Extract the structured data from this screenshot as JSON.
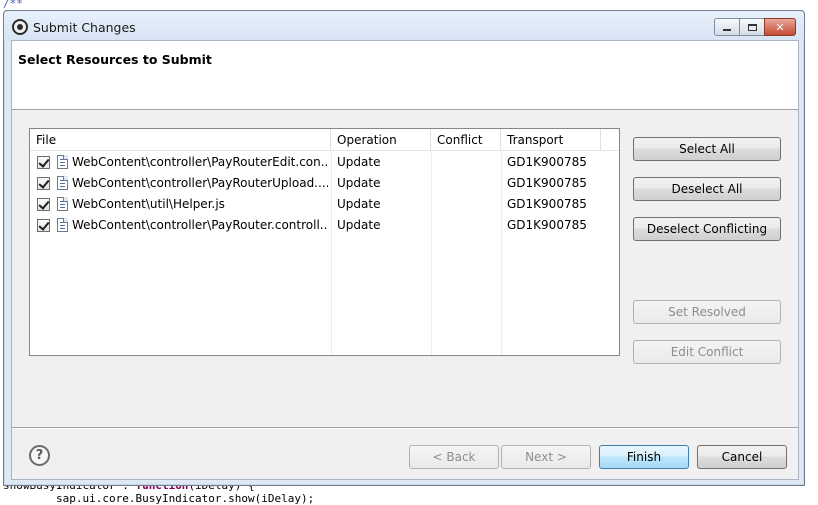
{
  "background_editor": {
    "top_fragment": "/**",
    "code_line_prefix": "showBusyIndicator : ",
    "code_keyword": "function",
    "code_line_suffix": "(iDelay) {",
    "code_line_2": "        sap.ui.core.BusyIndicator.show(iDelay);"
  },
  "window": {
    "title": "Submit Changes",
    "icon": "eclipse-gear-icon"
  },
  "header": {
    "title": "Select Resources to Submit"
  },
  "table": {
    "columns": [
      "File",
      "Operation",
      "Conflict",
      "Transport"
    ],
    "rows": [
      {
        "checked": true,
        "file": "WebContent\\controller\\PayRouterEdit.con...",
        "operation": "Update",
        "conflict": "",
        "transport": "GD1K900785"
      },
      {
        "checked": true,
        "file": "WebContent\\controller\\PayRouterUpload....",
        "operation": "Update",
        "conflict": "",
        "transport": "GD1K900785"
      },
      {
        "checked": true,
        "file": "WebContent\\util\\Helper.js",
        "operation": "Update",
        "conflict": "",
        "transport": "GD1K900785"
      },
      {
        "checked": true,
        "file": "WebContent\\controller\\PayRouter.controll...",
        "operation": "Update",
        "conflict": "",
        "transport": "GD1K900785"
      }
    ]
  },
  "side_buttons": {
    "select_all": "Select All",
    "deselect_all": "Deselect All",
    "deselect_conflicting": "Deselect Conflicting",
    "set_resolved": "Set Resolved",
    "edit_conflict": "Edit Conflict"
  },
  "footer": {
    "help": "?",
    "back": "< Back",
    "next": "Next >",
    "finish": "Finish",
    "cancel": "Cancel"
  }
}
